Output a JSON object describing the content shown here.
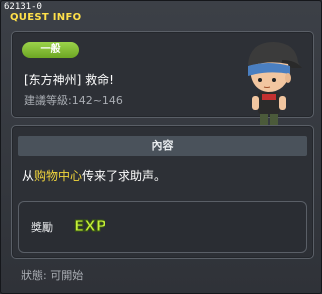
{
  "window": {
    "quest_id": "62131-0",
    "title": "QUEST INFO"
  },
  "quest": {
    "category_badge": "一般",
    "name": "[东方神州] 救命!",
    "level_label": "建議等級:142~146"
  },
  "content": {
    "header": "內容",
    "description_prefix": "从",
    "description_highlight": "购物中心",
    "description_suffix": "传来了求助声。"
  },
  "reward": {
    "label": "獎勵",
    "icon": "exp-icon",
    "icon_text": "EXP"
  },
  "status": {
    "text": "狀態: 可開始"
  },
  "colors": {
    "title": "#ffe04a",
    "badge": "#8cc63f",
    "highlight": "#f2d63c",
    "exp": "#c6f03a"
  }
}
